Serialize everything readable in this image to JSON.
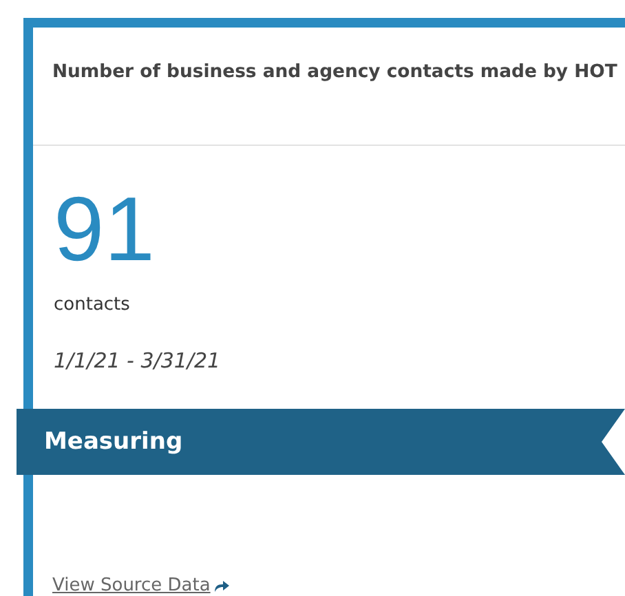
{
  "card": {
    "title": "Number of business and agency contacts made by HOT",
    "value": "91",
    "unit": "contacts",
    "period": "1/1/21 - 3/31/21",
    "banner": "Measuring",
    "link": "View Source Data"
  }
}
